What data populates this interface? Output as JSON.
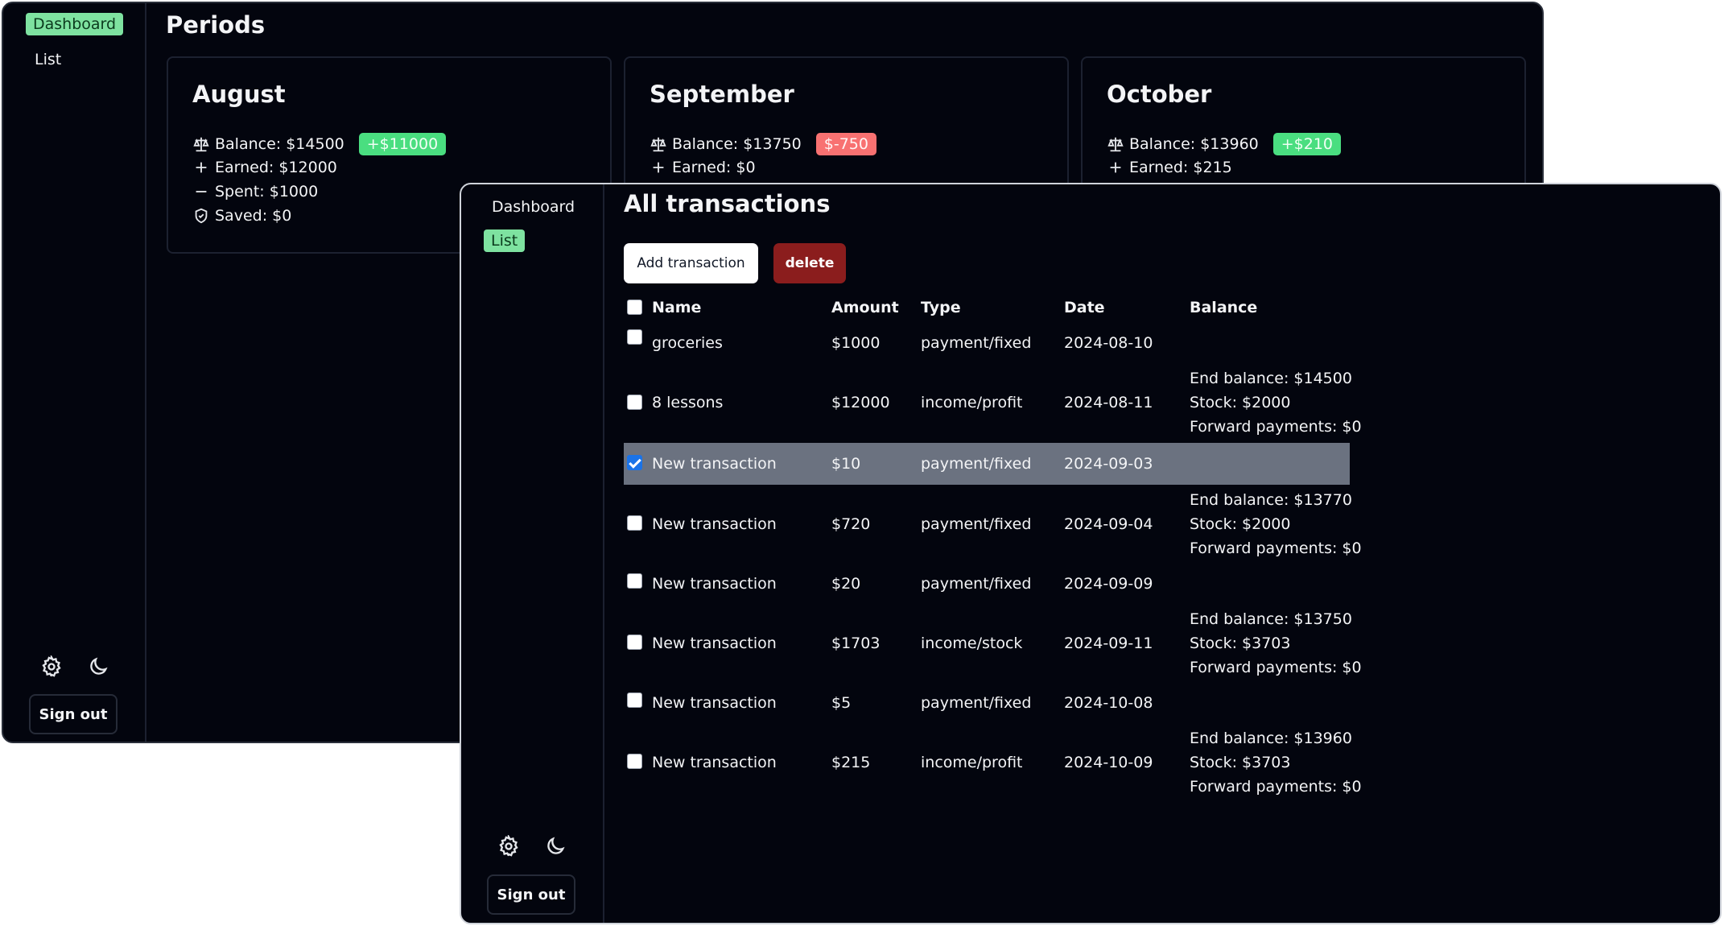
{
  "dashboard_window": {
    "sidebar": {
      "items": [
        {
          "label": "Dashboard",
          "active": true
        },
        {
          "label": "List",
          "active": false
        }
      ],
      "icons": [
        "gear-icon",
        "moon-icon"
      ],
      "sign_out_label": "Sign out"
    },
    "page_title": "Periods",
    "periods": [
      {
        "month": "August",
        "balance": "Balance: $14500",
        "delta": "+$11000",
        "delta_kind": "positive",
        "earned": "Earned: $12000",
        "spent": "Spent: $1000",
        "saved": "Saved: $0"
      },
      {
        "month": "September",
        "balance": "Balance: $13750",
        "delta": "$-750",
        "delta_kind": "negative",
        "earned": "Earned: $0"
      },
      {
        "month": "October",
        "balance": "Balance: $13960",
        "delta": "+$210",
        "delta_kind": "positive",
        "earned": "Earned: $215"
      }
    ]
  },
  "list_window": {
    "sidebar": {
      "items": [
        {
          "label": "Dashboard",
          "active": false
        },
        {
          "label": "List",
          "active": true
        }
      ],
      "icons": [
        "gear-icon",
        "moon-icon"
      ],
      "sign_out_label": "Sign out"
    },
    "page_title": "All transactions",
    "add_button_label": "Add transaction",
    "delete_button_label": "delete",
    "table": {
      "headers": [
        "Name",
        "Amount",
        "Type",
        "Date",
        "Balance"
      ],
      "rows": [
        {
          "checked": false,
          "selected": false,
          "name": "groceries",
          "amount": "$1000",
          "type": "payment/fixed",
          "date": "2024-08-10",
          "balance": []
        },
        {
          "checked": false,
          "selected": false,
          "name": "8 lessons",
          "amount": "$12000",
          "type": "income/profit",
          "date": "2024-08-11",
          "balance": [
            "End balance: $14500",
            "Stock: $2000",
            "Forward payments: $0"
          ]
        },
        {
          "checked": true,
          "selected": true,
          "name": "New transaction",
          "amount": "$10",
          "type": "payment/fixed",
          "date": "2024-09-03",
          "balance": []
        },
        {
          "checked": false,
          "selected": false,
          "name": "New transaction",
          "amount": "$720",
          "type": "payment/fixed",
          "date": "2024-09-04",
          "balance": [
            "End balance: $13770",
            "Stock: $2000",
            "Forward payments: $0"
          ]
        },
        {
          "checked": false,
          "selected": false,
          "name": "New transaction",
          "amount": "$20",
          "type": "payment/fixed",
          "date": "2024-09-09",
          "balance": []
        },
        {
          "checked": false,
          "selected": false,
          "name": "New transaction",
          "amount": "$1703",
          "type": "income/stock",
          "date": "2024-09-11",
          "balance": [
            "End balance: $13750",
            "Stock: $3703",
            "Forward payments: $0"
          ]
        },
        {
          "checked": false,
          "selected": false,
          "name": "New transaction",
          "amount": "$5",
          "type": "payment/fixed",
          "date": "2024-10-08",
          "balance": []
        },
        {
          "checked": false,
          "selected": false,
          "name": "New transaction",
          "amount": "$215",
          "type": "income/profit",
          "date": "2024-10-09",
          "balance": [
            "End balance: $13960",
            "Stock: $3703",
            "Forward payments: $0"
          ]
        }
      ]
    }
  },
  "colors": {
    "background": "#03050e",
    "active_nav": "#7ee2a0",
    "positive": "#4ade80",
    "negative": "#f87171",
    "delete_button": "#8b1d1d",
    "selected_row": "#6b7280"
  }
}
